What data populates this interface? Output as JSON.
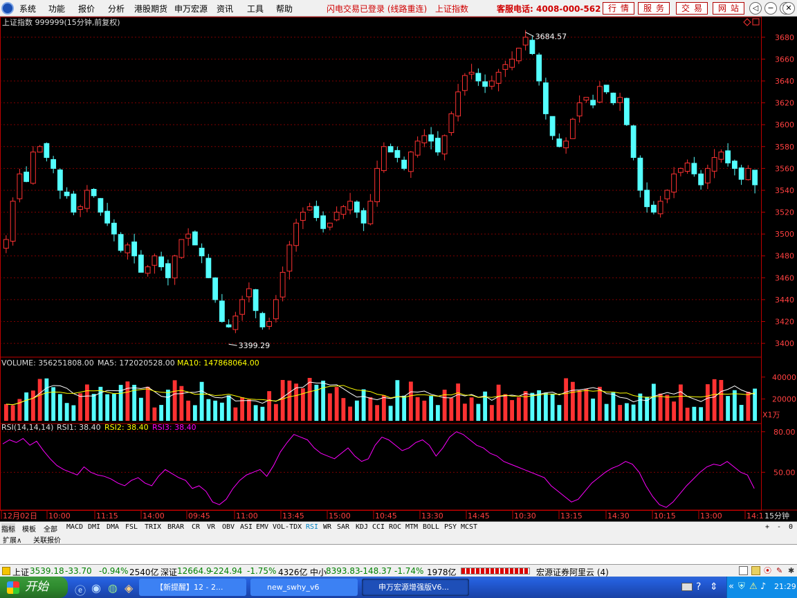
{
  "menu": {
    "items": [
      "系统",
      "功能",
      "报价",
      "分析",
      "港股期货",
      "申万宏源",
      "资讯",
      "工具",
      "帮助"
    ],
    "status_text": "闪电交易已登录 (线路重连)",
    "index_name": "上证指数",
    "hotline": "客服电话: 4008-000-562",
    "buttons": [
      "行情",
      "服务",
      "交易",
      "网站"
    ]
  },
  "chart": {
    "title": "上证指数 999999(15分钟,前复权)",
    "high_label": "3684.57",
    "low_label": "3399.29",
    "price_ticks": [
      "3680",
      "3660",
      "3640",
      "3620",
      "3600",
      "3580",
      "3560",
      "3540",
      "3520",
      "3500",
      "3480",
      "3460",
      "3440",
      "3420",
      "3400"
    ],
    "volume": {
      "label_volume": "VOLUME: 356251808.00",
      "label_ma5": "MA5: 172020528.00",
      "label_ma10": "MA10: 147868064.00",
      "ticks": [
        "40000",
        "20000"
      ],
      "unit": "X1万"
    },
    "rsi": {
      "label_params": "RSI(14,14,14)",
      "label_rsi1": "RSI1: 38.40",
      "label_rsi2": "RSI2: 38.40",
      "label_rsi3": "RSI3: 38.40",
      "ticks": [
        "80.00",
        "50.00"
      ]
    },
    "time_axis": [
      "12月02日",
      "10:00",
      "11:15",
      "14:00",
      "09:45",
      "11:00",
      "13:45",
      "15:00",
      "10:45",
      "13:30",
      "14:45",
      "10:30",
      "13:15",
      "14:30",
      "10:15",
      "13:00",
      "14:1"
    ],
    "period": "15分钟",
    "colors": {
      "up": "#ff3232",
      "down": "#54ffff",
      "ma5": "#ffffff",
      "ma10": "#ffff00",
      "rsi": "#ff00ff",
      "axis": "#c00000"
    }
  },
  "indicator_tabs": [
    "指标",
    "模板",
    "全部",
    "MACD",
    "DMI",
    "DMA",
    "FSL",
    "TRIX",
    "BRAR",
    "CR",
    "VR",
    "OBV",
    "ASI",
    "EMV",
    "VOL-TDX",
    "RSI",
    "WR",
    "SAR",
    "KDJ",
    "CCI",
    "ROC",
    "MTM",
    "BOLL",
    "PSY",
    "MCST"
  ],
  "active_tab": "RSI",
  "tab_controls": [
    "+",
    "-",
    "0"
  ],
  "subtabs": [
    "扩展∧",
    "关联报价"
  ],
  "status": {
    "sh_label": "上证",
    "sh_value": "3539.18",
    "sh_change": "-33.70",
    "sh_pct": "-0.94%",
    "sh_amount": "2540亿",
    "sz_label": "深证",
    "sz_value": "12664.9",
    "sz_change": "-224.94",
    "sz_pct": "-1.75%",
    "sz_amount": "4326亿",
    "zx_label": "中小",
    "zx_value": "8393.83",
    "zx_change": "-148.37",
    "zx_pct": "-1.74%",
    "zx_amount": "1978亿",
    "server": "宏源证券阿里云 (4)"
  },
  "taskbar": {
    "start": "开始",
    "tasks": [
      "【新提醒】12 - 2...",
      "new_swhy_v6",
      "申万宏源增强版V6..."
    ],
    "clock": "21:29"
  },
  "chart_data": {
    "type": "candlestick",
    "title": "上证指数 999999(15分钟,前复权)",
    "price_range": [
      3395,
      3690
    ],
    "close": [
      3495,
      3530,
      3555,
      3548,
      3575,
      3580,
      3570,
      3560,
      3540,
      3535,
      3520,
      3525,
      3540,
      3535,
      3520,
      3510,
      3500,
      3485,
      3490,
      3480,
      3465,
      3470,
      3480,
      3470,
      3460,
      3480,
      3495,
      3500,
      3490,
      3480,
      3460,
      3440,
      3420,
      3415,
      3425,
      3440,
      3450,
      3430,
      3415,
      3420,
      3440,
      3465,
      3490,
      3510,
      3520,
      3525,
      3515,
      3505,
      3510,
      3520,
      3525,
      3530,
      3520,
      3510,
      3530,
      3560,
      3580,
      3575,
      3570,
      3560,
      3575,
      3585,
      3590,
      3585,
      3575,
      3590,
      3610,
      3630,
      3645,
      3648,
      3640,
      3635,
      3640,
      3648,
      3655,
      3660,
      3670,
      3680,
      3665,
      3640,
      3610,
      3590,
      3580,
      3585,
      3605,
      3620,
      3625,
      3618,
      3635,
      3630,
      3620,
      3625,
      3600,
      3570,
      3540,
      3525,
      3520,
      3530,
      3540,
      3555,
      3560,
      3565,
      3555,
      3545,
      3560,
      3570,
      3575,
      3565,
      3560,
      3550,
      3560,
      3545
    ],
    "volume_range": [
      0,
      50000
    ],
    "rsi_range": [
      22,
      85
    ],
    "rsi": [
      71,
      74,
      72,
      75,
      70,
      73,
      66,
      60,
      55,
      52,
      50,
      48,
      54,
      50,
      48,
      47,
      45,
      42,
      40,
      44,
      46,
      42,
      40,
      47,
      52,
      49,
      46,
      44,
      38,
      40,
      36,
      28,
      26,
      30,
      38,
      44,
      48,
      50,
      52,
      47,
      55,
      65,
      72,
      78,
      76,
      74,
      68,
      64,
      62,
      60,
      64,
      68,
      62,
      58,
      60,
      70,
      76,
      74,
      70,
      66,
      68,
      72,
      74,
      70,
      62,
      68,
      76,
      80,
      78,
      74,
      70,
      68,
      64,
      62,
      58,
      56,
      54,
      52,
      50,
      48,
      46,
      40,
      36,
      32,
      28,
      30,
      36,
      42,
      46,
      50,
      53,
      55,
      58,
      56,
      50,
      40,
      32,
      26,
      24,
      28,
      34,
      40,
      45,
      50,
      54,
      56,
      55,
      58,
      54,
      50,
      48,
      38
    ],
    "series": []
  }
}
